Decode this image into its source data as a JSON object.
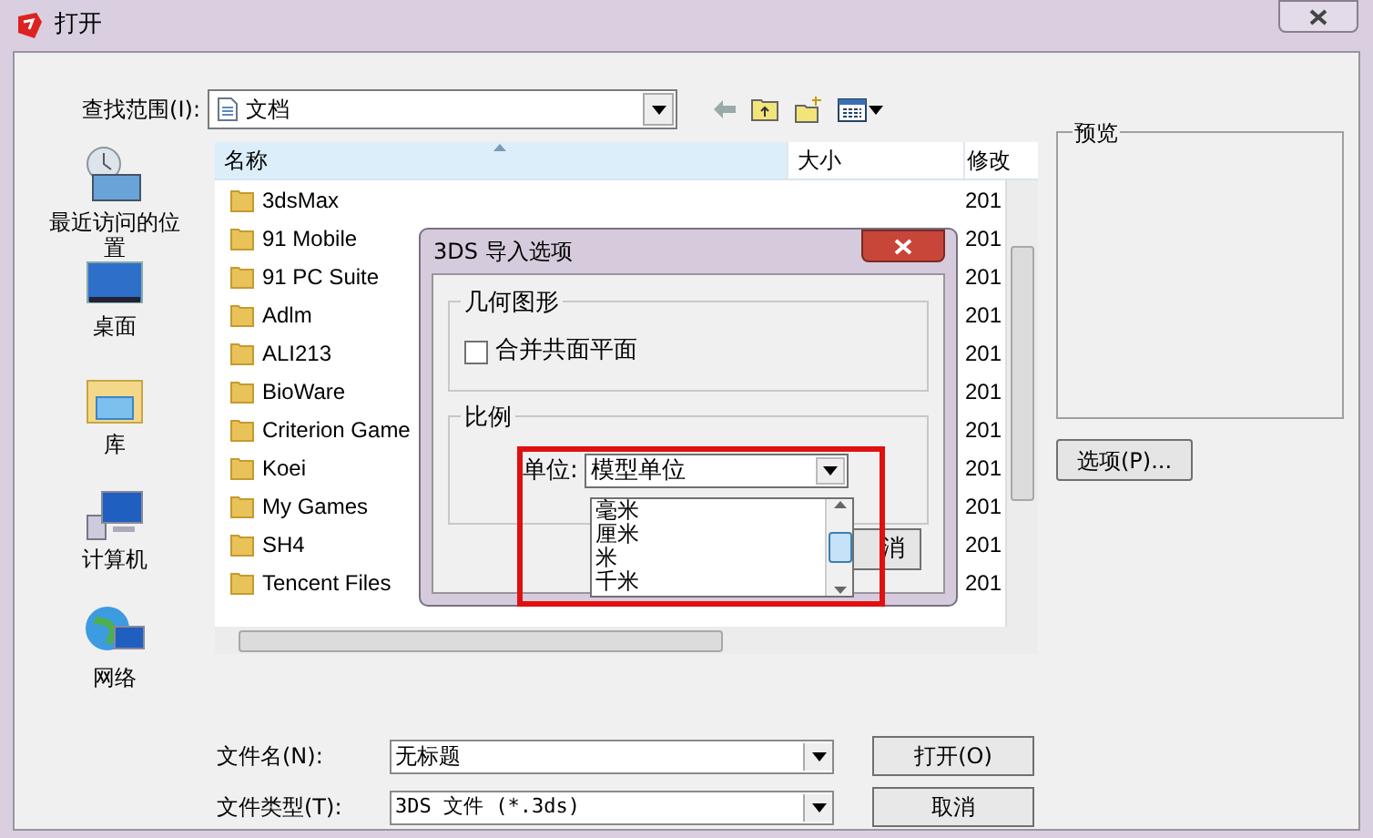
{
  "window": {
    "title": "打开"
  },
  "look_in": {
    "label": "查找范围(I):",
    "value": "文档"
  },
  "places": [
    {
      "kind": "recent",
      "label": "最近访问的位置"
    },
    {
      "kind": "desktop",
      "label": "桌面"
    },
    {
      "kind": "library",
      "label": "库"
    },
    {
      "kind": "computer",
      "label": "计算机"
    },
    {
      "kind": "network",
      "label": "网络"
    }
  ],
  "file_list": {
    "columns": [
      "名称",
      "大小",
      "修改"
    ],
    "rows": [
      {
        "name": "3dsMax",
        "date": "201"
      },
      {
        "name": "91 Mobile",
        "date": "201"
      },
      {
        "name": "91 PC Suite",
        "date": "201"
      },
      {
        "name": "Adlm",
        "date": "201"
      },
      {
        "name": "ALI213",
        "date": "201"
      },
      {
        "name": "BioWare",
        "date": "201"
      },
      {
        "name": "Criterion Game",
        "date": "201"
      },
      {
        "name": "Koei",
        "date": "201"
      },
      {
        "name": "My Games",
        "date": "201"
      },
      {
        "name": "SH4",
        "date": "201"
      },
      {
        "name": "Tencent Files",
        "date": "201"
      }
    ]
  },
  "preview": {
    "title": "预览"
  },
  "options_button": "选项(P)...",
  "file_name": {
    "label": "文件名(N):",
    "value": "无标题"
  },
  "file_type": {
    "label": "文件类型(T):",
    "value": "3DS 文件 (*.3ds)"
  },
  "buttons": [
    "打开(O)",
    "取消"
  ],
  "import_dialog": {
    "title": "3DS 导入选项",
    "geometry": {
      "title": "几何图形",
      "merge": {
        "label": "合并共面平面",
        "checked": false
      }
    },
    "scale": {
      "title": "比例",
      "unit_label": "单位:",
      "unit_value": "模型单位",
      "options": [
        {
          "label": "毫米",
          "selected": false
        },
        {
          "label": "厘米",
          "selected": false
        },
        {
          "label": "米",
          "selected": false
        },
        {
          "label": "千米",
          "selected": false
        }
      ]
    },
    "cancel_button": "消"
  }
}
